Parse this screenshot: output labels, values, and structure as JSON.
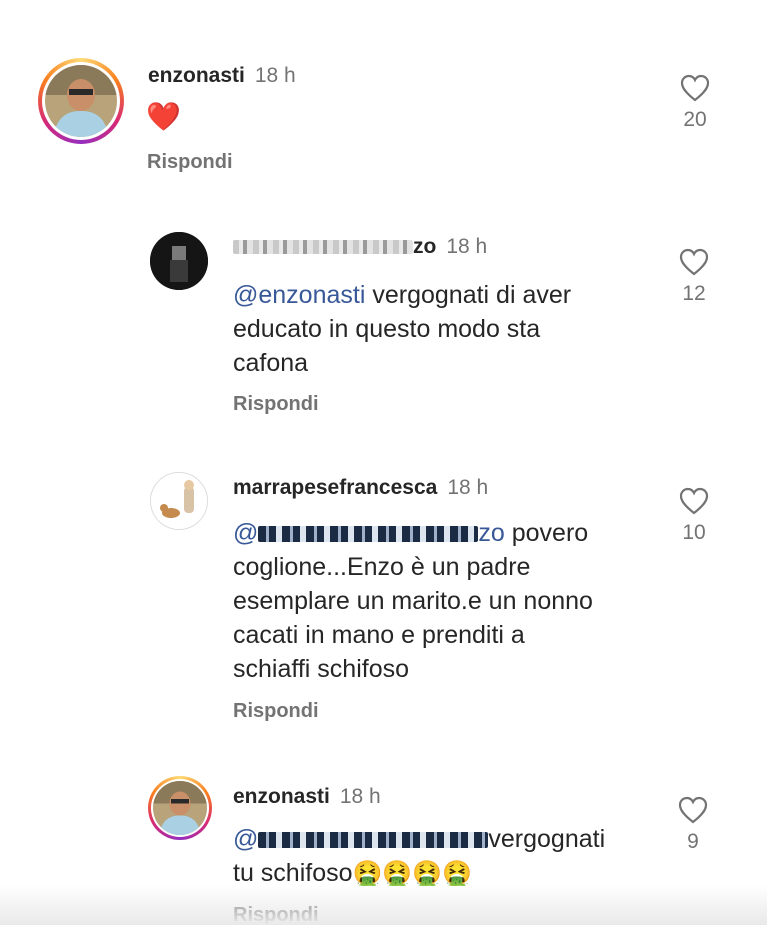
{
  "reply_label": "Rispondi",
  "colors": {
    "mention": "#385898",
    "meta": "#737373",
    "text": "#262626"
  },
  "comments": [
    {
      "username": "enzonasti",
      "time": "18 h",
      "text": "❤️",
      "likes": "20",
      "avatar": "profile-photo-story-ring"
    },
    {
      "username": "zo",
      "time": "18 h",
      "mention": "@enzonasti",
      "text_line1": "vergognati di aver",
      "text_line2": "educato in questo modo sta",
      "text_line3": "cafona",
      "likes": "12",
      "avatar": "profile-photo-dark"
    },
    {
      "username": "marrapesefrancesca",
      "time": "18 h",
      "mention_start": "@",
      "mention_end": "zo",
      "text_line1": "povero",
      "text_line2": "coglione...Enzo è un padre",
      "text_line3": "esemplare un marito.e un nonno",
      "text_line4": "cacati in mano e prenditi a",
      "text_line5": "schiaffi schifoso",
      "likes": "10",
      "avatar": "cartoon-child-dog"
    },
    {
      "username": "enzonasti",
      "time": "18 h",
      "mention_start": "@",
      "text_line1": "vergognati",
      "text_line2": "tu schifoso",
      "emojis": "🤮🤮🤮🤮",
      "likes": "9",
      "avatar": "profile-photo-story-ring"
    }
  ]
}
